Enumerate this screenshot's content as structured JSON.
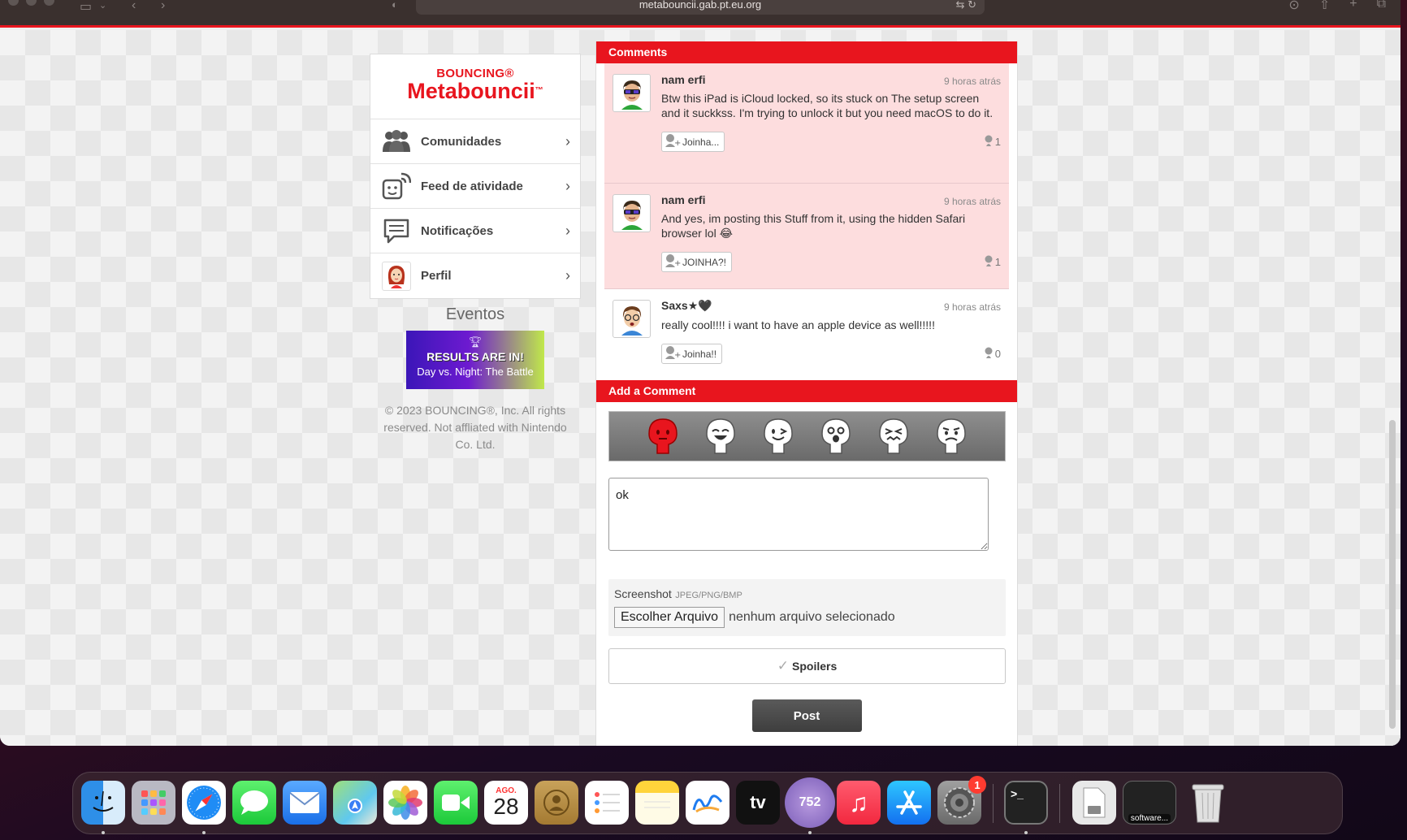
{
  "browser": {
    "url": "metabouncii.gab.pt.eu.org"
  },
  "sidebar": {
    "logo_top": "BOUNCING®",
    "logo_main": "Metabouncii",
    "logo_tm": "™",
    "items": [
      {
        "label": "Comunidades",
        "icon": "communities-icon"
      },
      {
        "label": "Feed de atividade",
        "icon": "activity-feed-icon"
      },
      {
        "label": "Notificações",
        "icon": "notifications-icon"
      },
      {
        "label": "Perfil",
        "icon": "profile-avatar-icon"
      }
    ],
    "events_title": "Eventos",
    "event_banner": {
      "line1": "RESULTS ARE IN!",
      "line2": "Day vs. Night: The Battle"
    },
    "copyright": "© 2023 BOUNCING®, Inc. All rights reserved. Not affliated with Nintendo Co. Ltd."
  },
  "comments_section": {
    "title": "Comments",
    "comments": [
      {
        "name": "nam erfi",
        "time": "9 horas atrás",
        "text": "Btw this iPad is iCloud locked, so its stuck on The setup screen and it suckkss. I'm trying to unlock it but you need macOS to do it.",
        "yeah_label": "Joinha...",
        "count": "1"
      },
      {
        "name": "nam erfi",
        "time": "9 horas atrás",
        "text": "And yes, im posting this Stuff from it, using the hidden Safari browser lol 😂",
        "yeah_label": "JOINHA?!",
        "count": "1"
      },
      {
        "name": "Saxs★🖤",
        "time": "9 horas atrás",
        "text": "really cool!!!! i want to have an apple device as well!!!!!",
        "yeah_label": "Joinha!!",
        "count": "0"
      }
    ]
  },
  "add_comment": {
    "title": "Add a Comment",
    "textarea_value": "ok",
    "screenshot_label": "Screenshot",
    "screenshot_types": "JPEG/PNG/BMP",
    "file_button": "Escolher Arquivo",
    "file_status": "nenhum arquivo selecionado",
    "spoilers_label": "Spoilers",
    "post_label": "Post"
  },
  "dock": {
    "calendar_month": "AGO.",
    "calendar_day": "28",
    "tv_label": "tv",
    "counter_label": "752",
    "settings_badge": "1",
    "terminal_prompt": ">_",
    "software_label": "software..."
  },
  "colors": {
    "brand_red": "#e8151e",
    "comment_highlight": "#fdddde",
    "post_button": "#4a4a4a"
  }
}
